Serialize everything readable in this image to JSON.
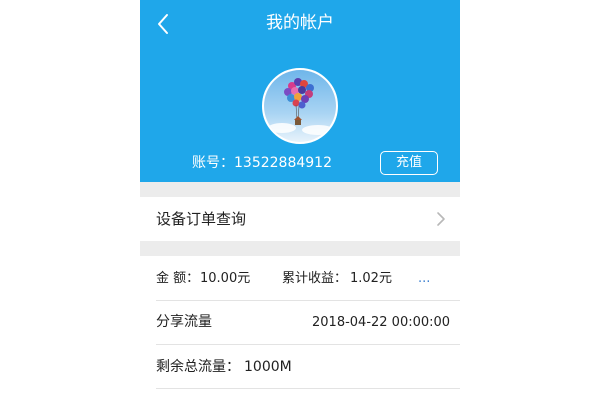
{
  "header": {
    "title": "我的帐户",
    "back_icon": "chevron-left-icon",
    "background_color": "#1fa7ea"
  },
  "profile": {
    "avatar_icon": "hot-air-balloon-avatar",
    "account_label": "账号：13522884912",
    "recharge_label": "充值"
  },
  "menu": {
    "device_orders_label": "设备订单查询",
    "chevron_icon": "chevron-right-icon"
  },
  "stats": {
    "amount_label": "金 额：",
    "amount_value": "10.00元",
    "earnings_label": "累计收益：",
    "earnings_value": "1.02元",
    "more_label": "...",
    "share_label": "分享流量",
    "share_time": "2018-04-22 00:00:00",
    "remaining_label": "剩余总流量：",
    "remaining_value": "1000M"
  }
}
